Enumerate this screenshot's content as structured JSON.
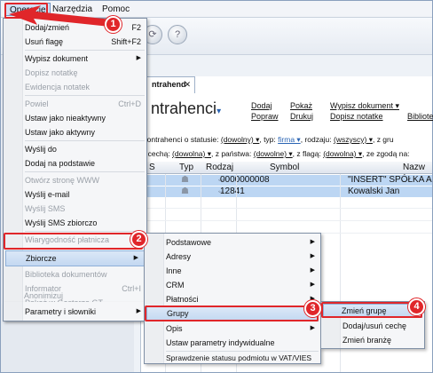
{
  "menubar": {
    "items": [
      {
        "label": "Operacje"
      },
      {
        "label": "Narzędzia"
      },
      {
        "label": "Pomoc"
      }
    ]
  },
  "tab": {
    "label": "ntrahend",
    "close": "✕"
  },
  "page": {
    "title": "ntrahenci",
    "title_caret": "▾"
  },
  "actions": {
    "dodaj": "Dodaj",
    "popraw": "Popraw",
    "pokaz": "Pokaż",
    "drukuj": "Drukuj",
    "wypisz": "Wypisz dokument ▾",
    "dopisz": "Dopisz notatke",
    "biblioteka": "Bibliote"
  },
  "filters": {
    "row1": {
      "prefix": "Kontrahenci o statusie:",
      "status": "(dowolny) ▾",
      "typ_label": ", typ:",
      "typ": "firma ▾",
      "rodzaj_label": ", rodzaju:",
      "rodzaj": "(wszyscy) ▾",
      "tail": ", z gru"
    },
    "row2": {
      "prefix": "z cechą:",
      "cecha": "(dowolna) ▾",
      "panstwo_label": ", z państwa:",
      "panstwo": "(dowolne) ▾",
      "flaga_label": ", z flagą:",
      "flaga": "(dowolna) ▾",
      "tail": ", ze zgodą na:"
    }
  },
  "grid": {
    "columns": [
      "S",
      "Typ",
      "Rodzaj",
      "Symbol",
      "Nazw"
    ],
    "rows": [
      {
        "symbol": "0000000008",
        "name": "\"INSERT\" SPÓŁKA A"
      },
      {
        "symbol": "12841",
        "name": "Kowalski Jan"
      }
    ]
  },
  "menu1": {
    "items": [
      {
        "label": "Dodaj/zmień",
        "shortcut": "F2"
      },
      {
        "label": "Usuń flagę",
        "shortcut": "Shift+F2"
      },
      {
        "label": "Wypisz dokument",
        "submenu": true
      },
      {
        "label": "Dopisz notatkę"
      },
      {
        "label": "Ewidencja notatek"
      },
      {
        "label": "Powiel",
        "shortcut": "Ctrl+D"
      },
      {
        "label": "Ustaw jako nieaktywny"
      },
      {
        "label": "Ustaw jako aktywny"
      },
      {
        "label": "Wyślij do"
      },
      {
        "label": "Dodaj na podstawie"
      },
      {
        "label": "Otwórz stronę WWW"
      },
      {
        "label": "Wyślij e-mail"
      },
      {
        "label": "Wyślij SMS"
      },
      {
        "label": "Wyślij SMS zbiorczo"
      },
      {
        "label": "Wiarygodność płatnicza"
      },
      {
        "label": "Zbiorcze",
        "submenu": true
      },
      {
        "label": "Biblioteka dokumentów"
      },
      {
        "label": "Informator",
        "shortcut": "Ctrl+I"
      },
      {
        "label": "Pokaż w Gestorze GT"
      },
      {
        "label": "Anonimizuj"
      },
      {
        "label": "Parametry i słowniki",
        "submenu": true
      }
    ]
  },
  "menu2": {
    "items": [
      {
        "label": "Podstawowe"
      },
      {
        "label": "Adresy"
      },
      {
        "label": "Inne"
      },
      {
        "label": "CRM"
      },
      {
        "label": "Płatności"
      },
      {
        "label": "Grupy"
      },
      {
        "label": "Opis"
      },
      {
        "label": "Ustaw parametry indywidualne"
      },
      {
        "label": "Sprawdzenie statusu podmiotu w VAT/VIES"
      }
    ]
  },
  "menu3": {
    "items": [
      {
        "label": "Zmień grupę"
      },
      {
        "label": "Dodaj/usuń cechę"
      },
      {
        "label": "Zmień branżę"
      }
    ]
  },
  "badges": [
    "1",
    "2",
    "3",
    "4"
  ],
  "colors": {
    "accent_red": "#e0262a",
    "highlight": "#c3d8f1",
    "selected_row": "#bcd6f3"
  }
}
